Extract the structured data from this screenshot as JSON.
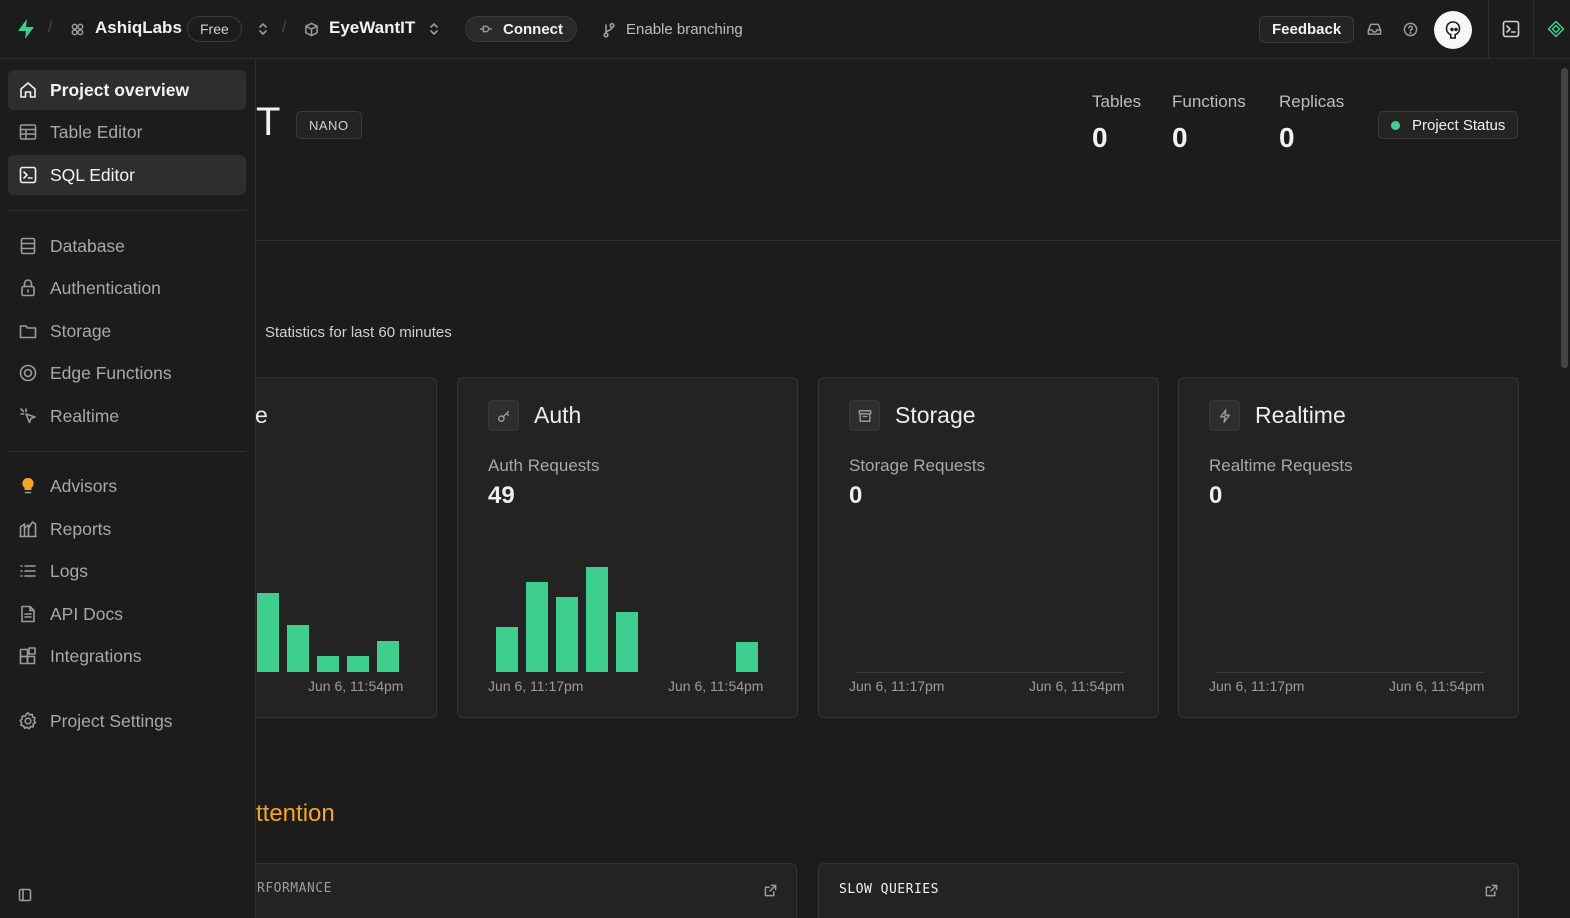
{
  "topbar": {
    "org_name": "AshiqLabs",
    "plan_badge": "Free",
    "project_name": "EyeWantIT",
    "connect_label": "Connect",
    "branching_label": "Enable branching",
    "feedback_label": "Feedback"
  },
  "header": {
    "title_fragment": "T",
    "instance_badge": "NANO",
    "status_label": "Project Status",
    "stats": [
      {
        "label": "Tables",
        "value": "0"
      },
      {
        "label": "Functions",
        "value": "0"
      },
      {
        "label": "Replicas",
        "value": "0"
      }
    ]
  },
  "usage": {
    "stats_caption": "Statistics for last 60 minutes",
    "cards": [
      {
        "title": "e",
        "subtitle": "",
        "value": "",
        "date_start": "",
        "date_end": "Jun 6, 11:54pm",
        "icon": "database-icon"
      },
      {
        "title": "Auth",
        "subtitle": "Auth Requests",
        "value": "49",
        "date_start": "Jun 6, 11:17pm",
        "date_end": "Jun 6, 11:54pm",
        "icon": "key-icon"
      },
      {
        "title": "Storage",
        "subtitle": "Storage Requests",
        "value": "0",
        "date_start": "Jun 6, 11:17pm",
        "date_end": "Jun 6, 11:54pm",
        "icon": "archive-icon"
      },
      {
        "title": "Realtime",
        "subtitle": "Realtime Requests",
        "value": "0",
        "date_start": "Jun 6, 11:17pm",
        "date_end": "Jun 6, 11:54pm",
        "icon": "bolt-icon"
      }
    ]
  },
  "chart_data": [
    {
      "type": "bar",
      "title": "Database",
      "series": [
        {
          "values": [
            15,
            9,
            3,
            3,
            6
          ]
        }
      ],
      "ylim": [
        0,
        20
      ],
      "x": [
        "",
        "Jun 6, 11:54pm"
      ]
    },
    {
      "type": "bar",
      "title": "Auth Requests",
      "series": [
        {
          "values": [
            6,
            12,
            10,
            14,
            8,
            0,
            0,
            0,
            4
          ]
        }
      ],
      "ylim": [
        0,
        14
      ],
      "x": [
        "Jun 6, 11:17pm",
        "Jun 6, 11:54pm"
      ]
    }
  ],
  "attention": {
    "heading_fragment": "ttention",
    "card_left_label": "RFORMANCE",
    "card_right_label": "SLOW QUERIES"
  },
  "sidebar": {
    "items": [
      {
        "label": "Project overview"
      },
      {
        "label": "Table Editor"
      },
      {
        "label": "SQL Editor"
      },
      {
        "label": "Database"
      },
      {
        "label": "Authentication"
      },
      {
        "label": "Storage"
      },
      {
        "label": "Edge Functions"
      },
      {
        "label": "Realtime"
      },
      {
        "label": "Advisors"
      },
      {
        "label": "Reports"
      },
      {
        "label": "Logs"
      },
      {
        "label": "API Docs"
      },
      {
        "label": "Integrations"
      },
      {
        "label": "Project Settings"
      }
    ]
  },
  "colors": {
    "accent": "#3ecf8e",
    "warning": "#f5a524",
    "background": "#1c1c1c"
  }
}
